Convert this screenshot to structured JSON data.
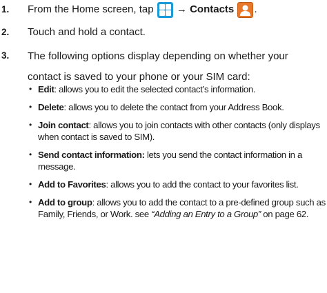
{
  "steps": [
    {
      "number": "1.",
      "prefix": "From the Home screen, tap",
      "icon1": "apps-grid-icon",
      "arrow": "→",
      "target": "Contacts",
      "icon2": "contacts-icon",
      "suffix": "."
    },
    {
      "number": "2.",
      "text": "Touch and hold a contact."
    },
    {
      "number": "3.",
      "text": "The following options display depending on whether your contact is saved to your phone or your SIM card:"
    }
  ],
  "options": [
    {
      "term": "Edit",
      "desc": ": allows you to edit the selected contact’s information."
    },
    {
      "term": "Delete",
      "desc": ": allows you to delete the contact from your Address Book."
    },
    {
      "term": "Join contact",
      "desc": ": allows you to join contacts with other contacts (only displays when contact is saved to SIM)."
    },
    {
      "term": "Send contact information:",
      "desc": " lets you send the contact information in a message."
    },
    {
      "term": "Add to Favorites",
      "desc": ": allows you to add the contact to your favorites list."
    },
    {
      "term": "Add to group",
      "desc": ": allows you to add the contact to a pre-defined group such as Family, Friends, or Work. see ",
      "ref": "“Adding an Entry to a Group”",
      "page": " on page 62."
    }
  ],
  "colors": {
    "apps_icon": "#1a9ad6",
    "contacts_icon": "#e8772a",
    "text": "#1a1a1a"
  }
}
